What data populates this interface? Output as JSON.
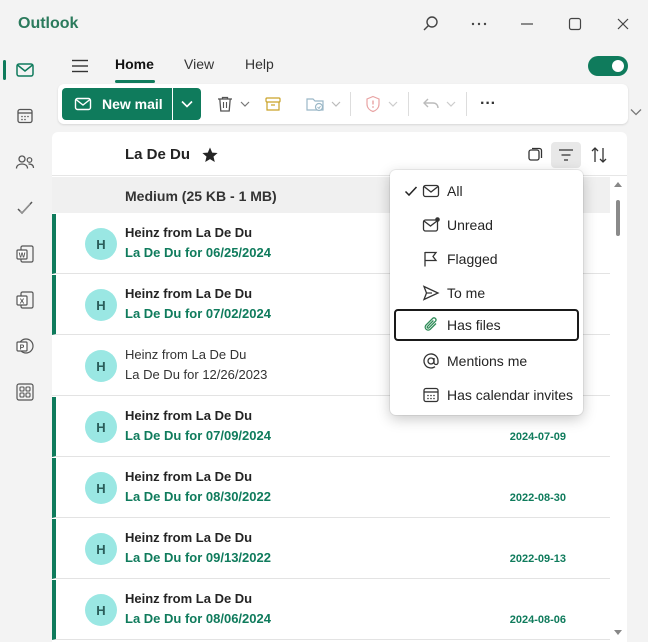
{
  "app": {
    "title": "Outlook"
  },
  "ribbon": {
    "tabs": [
      {
        "label": "Home"
      },
      {
        "label": "View"
      },
      {
        "label": "Help"
      }
    ],
    "new_mail_label": "New mail",
    "more_label": "···"
  },
  "folder": {
    "title": "La De Du",
    "group_label": "Medium (25 KB - 1 MB)"
  },
  "filter_menu": {
    "items": [
      {
        "label": "All",
        "icon": "mail-icon",
        "checked": true
      },
      {
        "label": "Unread",
        "icon": "mail-unread-icon",
        "checked": false
      },
      {
        "label": "Flagged",
        "icon": "flag-icon",
        "checked": false
      },
      {
        "label": "To me",
        "icon": "send-icon",
        "checked": false
      },
      {
        "label": "Has files",
        "icon": "paperclip-icon",
        "checked": false
      },
      {
        "label": "Mentions me",
        "icon": "at-icon",
        "checked": false
      },
      {
        "label": "Has calendar invites",
        "icon": "calendar-icon",
        "checked": false
      }
    ]
  },
  "messages": [
    {
      "initial": "H",
      "sender": "Heinz from La De Du",
      "subject": "La De Du for 06/25/2024",
      "date": "",
      "unread": true
    },
    {
      "initial": "H",
      "sender": "Heinz from La De Du",
      "subject": "La De Du for 07/02/2024",
      "date": "",
      "unread": true
    },
    {
      "initial": "H",
      "sender": "Heinz from La De Du",
      "subject": "La De Du for 12/26/2023",
      "date": "",
      "unread": false
    },
    {
      "initial": "H",
      "sender": "Heinz from La De Du",
      "subject": "La De Du for 07/09/2024",
      "date": "2024-07-09",
      "unread": true
    },
    {
      "initial": "H",
      "sender": "Heinz from La De Du",
      "subject": "La De Du for 08/30/2022",
      "date": "2022-08-30",
      "unread": true
    },
    {
      "initial": "H",
      "sender": "Heinz from La De Du",
      "subject": "La De Du for 09/13/2022",
      "date": "2022-09-13",
      "unread": true
    },
    {
      "initial": "H",
      "sender": "Heinz from La De Du",
      "subject": "La De Du for 08/06/2024",
      "date": "2024-08-06",
      "unread": true
    }
  ],
  "colors": {
    "accent": "#0f7b5c",
    "avatar": "#9ae7e3"
  }
}
